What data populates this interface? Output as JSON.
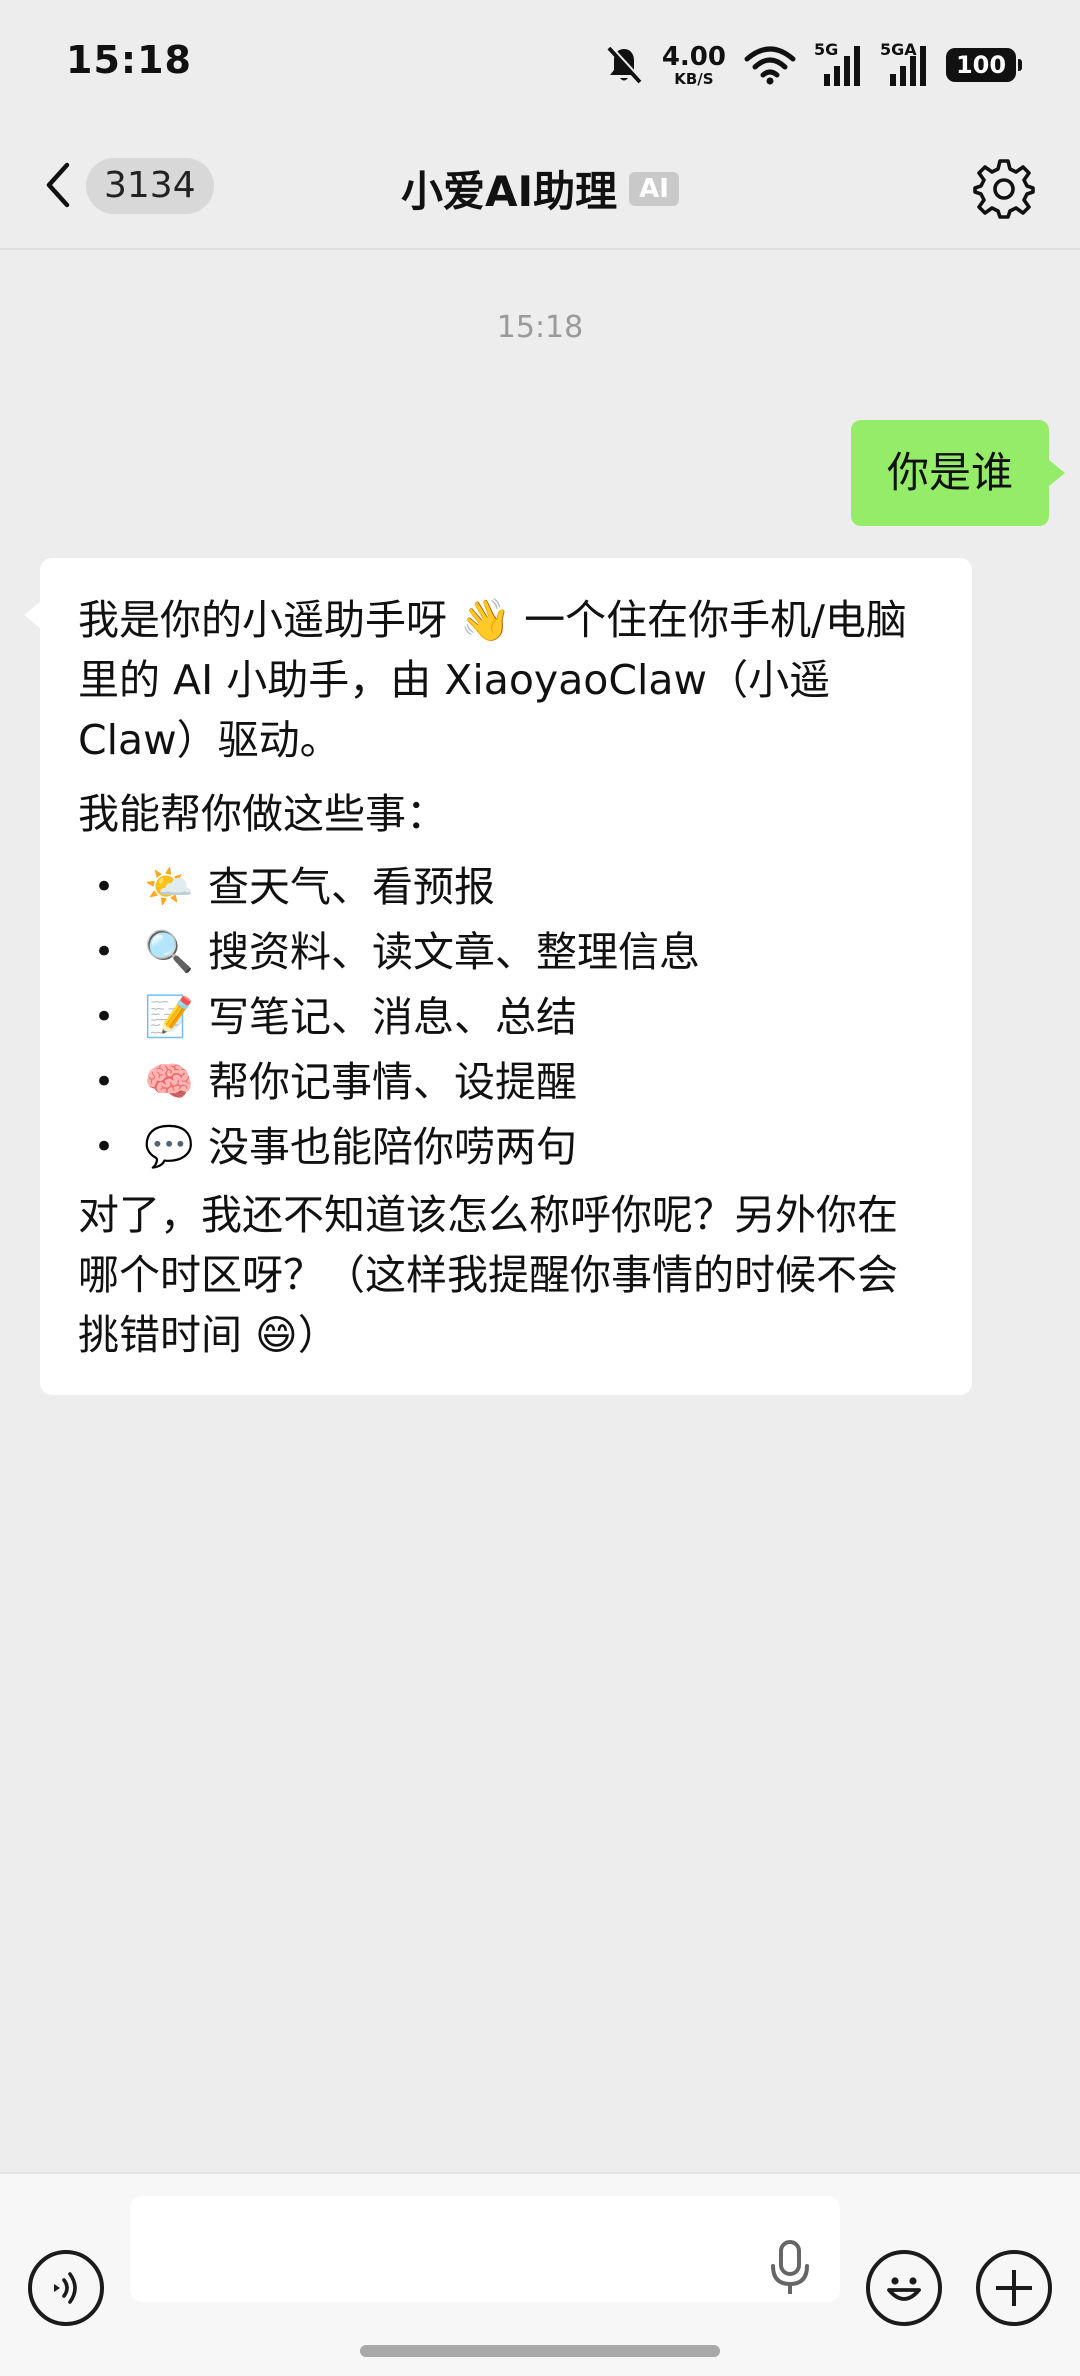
{
  "status_bar": {
    "time": "15:18",
    "net_speed_value": "4.00",
    "net_speed_unit": "KB/S",
    "signal_1_label": "5G",
    "signal_2_label": "5GA",
    "battery": "100"
  },
  "nav": {
    "unread_count": "3134",
    "title": "小爱AI助理",
    "ai_badge": "AI"
  },
  "chat": {
    "timestamp": "15:18",
    "user_message": "你是谁",
    "ai_message": {
      "intro": "我是你的小遥助手呀 👋 一个住在你手机/电脑里的 AI 小助手，由 XiaoyaoClaw（小遥Claw）驱动。",
      "capabilities_heading": "我能帮你做这些事：",
      "capabilities": [
        {
          "emoji": "🌤️",
          "text": "查天气、看预报"
        },
        {
          "emoji": "🔍",
          "text": "搜资料、读文章、整理信息"
        },
        {
          "emoji": "📝",
          "text": "写笔记、消息、总结"
        },
        {
          "emoji": "🧠",
          "text": "帮你记事情、设提醒"
        },
        {
          "emoji": "💬",
          "text": "没事也能陪你唠两句"
        }
      ],
      "outro": "对了，我还不知道该怎么称呼你呢？另外你在哪个时区呀？（这样我提醒你事情的时候不会挑错时间 😄）"
    }
  },
  "icons": {
    "back": "chevron-left-icon",
    "settings": "gear-icon",
    "voice": "voice-icon",
    "mic": "mic-icon",
    "emoji": "smile-icon",
    "plus": "plus-icon"
  },
  "colors": {
    "background": "#ededed",
    "user_bubble": "#95ec69",
    "ai_bubble": "#ffffff",
    "timestamp": "#9a9a9a"
  }
}
